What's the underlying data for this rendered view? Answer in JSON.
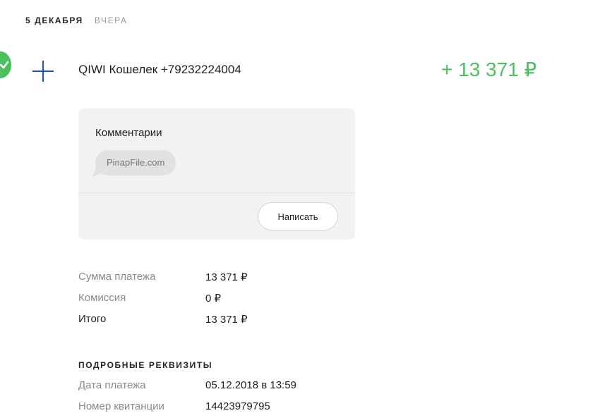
{
  "date_tabs": [
    {
      "label": "5 ДЕКАБРЯ",
      "active": true
    },
    {
      "label": "ВЧЕРА",
      "active": false
    }
  ],
  "transaction": {
    "status_icon": "check-icon",
    "type_icon": "plus-icon",
    "title": "QIWI Кошелек +79232224004",
    "amount": "+ 13 371 ₽"
  },
  "comments": {
    "title": "Комментарии",
    "items": [
      "PinapFile.com"
    ],
    "write_label": "Написать"
  },
  "summary": [
    {
      "label": "Сумма платежа",
      "value": "13 371 ₽"
    },
    {
      "label": "Комиссия",
      "value": "0 ₽"
    },
    {
      "label": "Итого",
      "value": "13 371 ₽"
    }
  ],
  "details": {
    "title": "ПОДРОБНЫЕ РЕКВИЗИТЫ",
    "rows": [
      {
        "label": "Дата платежа",
        "value": "05.12.2018 в 13:59"
      },
      {
        "label": "Номер квитанции",
        "value": "14423979795"
      }
    ]
  },
  "colors": {
    "accent_green": "#4cbf5f",
    "plus_blue": "#1b5bab",
    "card_bg": "#f2f2f2"
  }
}
